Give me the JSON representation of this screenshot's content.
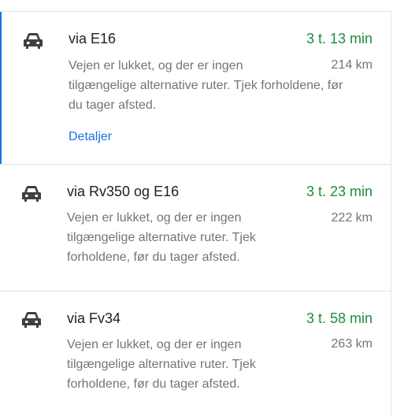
{
  "routes": [
    {
      "via": "via E16",
      "duration": "3 t. 13 min",
      "distance": "214 km",
      "warning_lines": [
        "Vejen er lukket, og der er ingen",
        "tilgængelige alternative ruter. Tjek forholdene, før",
        "du tager afsted."
      ],
      "details_label": "Detaljer",
      "icon": "car-icon"
    },
    {
      "via": "via Rv350 og E16",
      "duration": "3 t. 23 min",
      "distance": "222 km",
      "warning_lines": [
        "Vejen er lukket, og der er ingen",
        "tilgængelige alternative ruter. Tjek",
        "forholdene, før du tager afsted."
      ],
      "icon": "car-icon"
    },
    {
      "via": "via Fv34",
      "duration": "3 t. 58 min",
      "distance": "263 km",
      "warning_lines": [
        "Vejen er lukket, og der er ingen",
        "tilgængelige alternative ruter. Tjek",
        "forholdene, før du tager afsted."
      ],
      "icon": "car-icon"
    }
  ],
  "colors": {
    "duration": "#1e8e3e",
    "link": "#1a73e8",
    "secondary_text": "#70757a",
    "primary_text": "#202124",
    "selected_border": "#1a73e8"
  }
}
